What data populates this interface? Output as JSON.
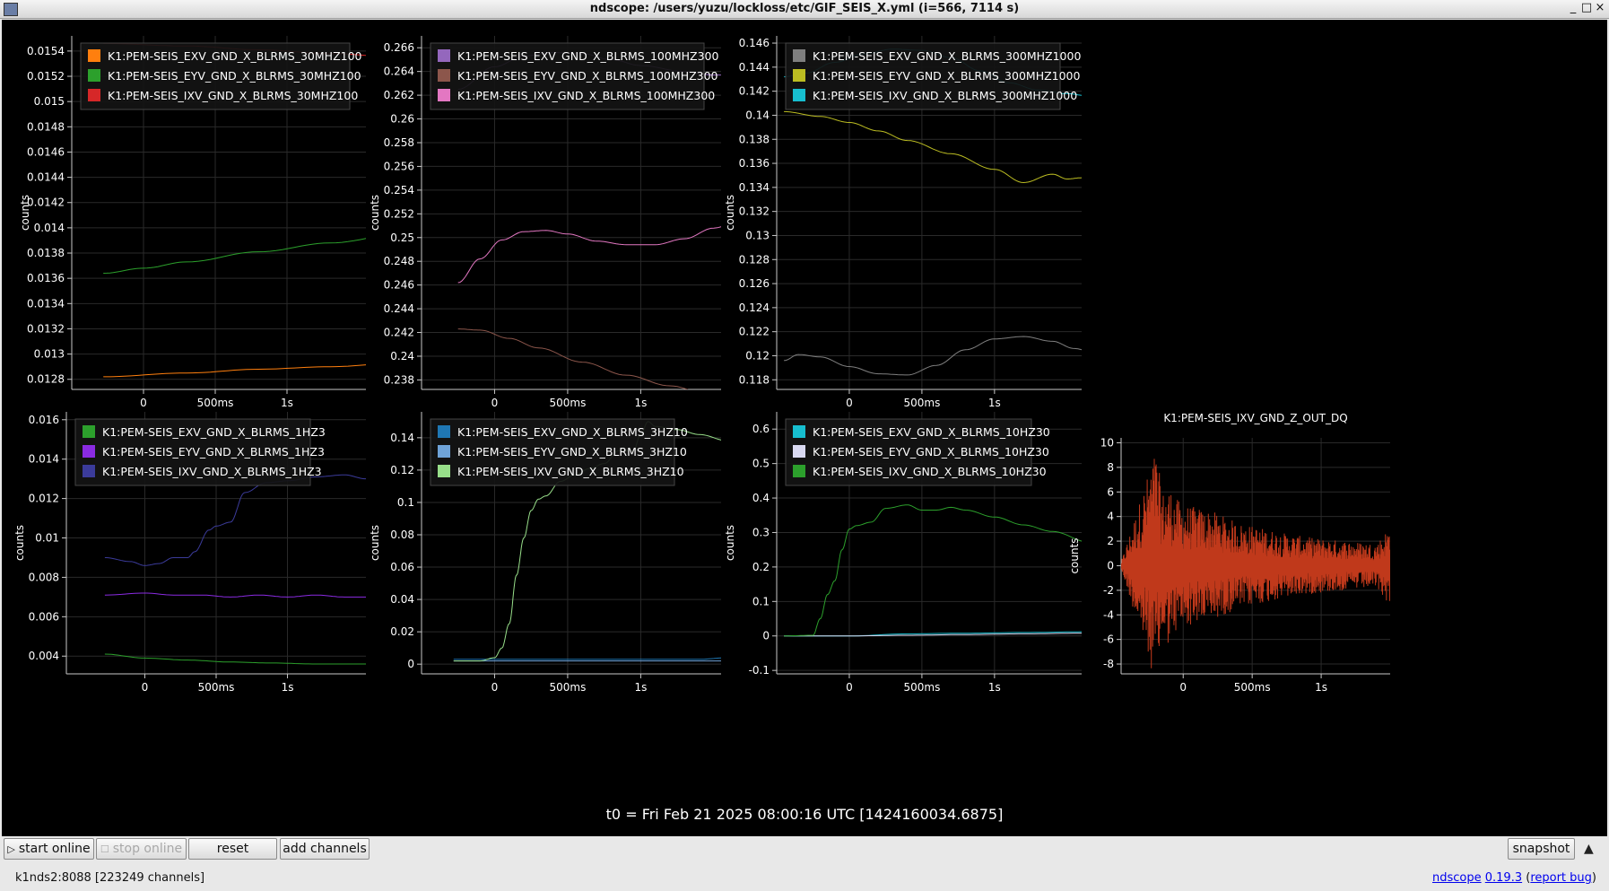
{
  "window": {
    "title": "ndscope: /users/yuzu/lockloss/etc/GIF_SEIS_X.yml (i=566, 7114 s)",
    "buttons": [
      "_",
      "□",
      "×"
    ]
  },
  "t0_label": "t0 = Fri Feb 21 2025 08:00:16 UTC [1424160034.6875]",
  "toolbar": {
    "start_online": "start online",
    "stop_online": "stop online",
    "reset": "reset",
    "add_channels": "add channels",
    "snapshot": "snapshot"
  },
  "status": {
    "server": "k1nds2:8088  [223249 channels]",
    "app": "ndscope",
    "version": "0.19.3",
    "report_open": "(",
    "report": "report bug",
    "report_close": ")"
  },
  "axes_common": {
    "ylabel": "counts",
    "xticks": [
      {
        "t": 0,
        "label": "0"
      },
      {
        "t": 0.5,
        "label": "500ms"
      },
      {
        "t": 1,
        "label": "1s"
      }
    ],
    "xlim": [
      -0.28,
      1.8
    ]
  },
  "colors": {
    "background": "#000000",
    "axis": "#c8c8c8",
    "grid": "#2a2a2a",
    "text": "#ffffff"
  },
  "chart_data": [
    {
      "type": "line",
      "ylim": [
        0.01272,
        0.01552
      ],
      "yticks": [
        "0.0154",
        "0.0152",
        "0.015",
        "0.0148",
        "0.0146",
        "0.0144",
        "0.0142",
        "0.014",
        "0.0138",
        "0.0136",
        "0.0134",
        "0.0132",
        "0.013",
        "0.0128"
      ],
      "series": [
        {
          "name": "K1:PEM-SEIS_EXV_GND_X_BLRMS_30MHZ100",
          "color": "#ff7f0e",
          "x": [
            -0.28,
            0.3,
            0.8,
            1.3,
            1.8
          ],
          "y": [
            0.01282,
            0.01285,
            0.01288,
            0.0129,
            0.01293
          ]
        },
        {
          "name": "K1:PEM-SEIS_EYV_GND_X_BLRMS_30MHZ100",
          "color": "#2ca02c",
          "x": [
            -0.28,
            0.0,
            0.3,
            0.8,
            1.3,
            1.8
          ],
          "y": [
            0.01364,
            0.01368,
            0.01373,
            0.01381,
            0.01388,
            0.01395
          ]
        },
        {
          "name": "K1:PEM-SEIS_IXV_GND_X_BLRMS_30MHZ100",
          "color": "#d62728",
          "x": [
            -0.28,
            0.3,
            0.8,
            1.3,
            1.8
          ],
          "y": [
            0.01546,
            0.01544,
            0.01541,
            0.01538,
            0.01535
          ]
        }
      ]
    },
    {
      "type": "line",
      "ylim": [
        0.2372,
        0.267
      ],
      "yticks": [
        "0.266",
        "0.264",
        "0.262",
        "0.26",
        "0.258",
        "0.256",
        "0.254",
        "0.252",
        "0.25",
        "0.248",
        "0.246",
        "0.244",
        "0.242",
        "0.24",
        "0.238"
      ],
      "series": [
        {
          "name": "K1:PEM-SEIS_EXV_GND_X_BLRMS_100MHZ300",
          "color": "#9467bd",
          "x": [
            -0.25,
            0.0,
            0.2,
            0.4,
            0.6,
            0.8,
            1.0,
            1.3,
            1.5,
            1.8
          ],
          "y": [
            0.2625,
            0.2644,
            0.2653,
            0.2656,
            0.2655,
            0.265,
            0.2645,
            0.264,
            0.2637,
            0.2637
          ]
        },
        {
          "name": "K1:PEM-SEIS_EYV_GND_X_BLRMS_100MHZ300",
          "color": "#8c564b",
          "x": [
            -0.25,
            -0.1,
            0.1,
            0.3,
            0.6,
            0.9,
            1.2,
            1.5,
            1.8
          ],
          "y": [
            0.2423,
            0.2422,
            0.2415,
            0.2407,
            0.2395,
            0.2384,
            0.2375,
            0.2366,
            0.2354
          ]
        },
        {
          "name": "K1:PEM-SEIS_IXV_GND_X_BLRMS_100MHZ300",
          "color": "#e377c2",
          "x": [
            -0.25,
            -0.1,
            0.05,
            0.2,
            0.35,
            0.5,
            0.7,
            0.9,
            1.1,
            1.3,
            1.5,
            1.8
          ],
          "y": [
            0.2462,
            0.2482,
            0.2498,
            0.2505,
            0.2506,
            0.2503,
            0.2497,
            0.2494,
            0.2494,
            0.2499,
            0.2508,
            0.2525
          ]
        }
      ]
    },
    {
      "type": "line",
      "ylim": [
        0.1172,
        0.1466
      ],
      "yticks": [
        "0.146",
        "0.144",
        "0.142",
        "0.14",
        "0.138",
        "0.136",
        "0.134",
        "0.132",
        "0.13",
        "0.128",
        "0.126",
        "0.124",
        "0.122",
        "0.12",
        "0.118"
      ],
      "series": [
        {
          "name": "K1:PEM-SEIS_EXV_GND_X_BLRMS_300MHZ1000",
          "color": "#7f7f7f",
          "x": [
            -0.45,
            -0.35,
            -0.2,
            0.0,
            0.2,
            0.4,
            0.6,
            0.8,
            1.0,
            1.2,
            1.4,
            1.55,
            1.65
          ],
          "y": [
            0.1196,
            0.1201,
            0.1199,
            0.1191,
            0.1185,
            0.1184,
            0.1192,
            0.1205,
            0.1214,
            0.1216,
            0.1212,
            0.1206,
            0.1204
          ]
        },
        {
          "name": "K1:PEM-SEIS_EYV_GND_X_BLRMS_300MHZ1000",
          "color": "#bcbd22",
          "x": [
            -0.45,
            -0.2,
            0.0,
            0.2,
            0.4,
            0.7,
            1.0,
            1.2,
            1.4,
            1.5,
            1.6,
            1.65
          ],
          "y": [
            0.1403,
            0.1399,
            0.1394,
            0.1387,
            0.1379,
            0.1368,
            0.1355,
            0.1344,
            0.1351,
            0.1347,
            0.1348,
            0.1348
          ]
        },
        {
          "name": "K1:PEM-SEIS_IXV_GND_X_BLRMS_300MHZ1000",
          "color": "#17becf",
          "x": [
            -0.45,
            -0.3,
            -0.1,
            0.1,
            0.3,
            0.5,
            0.7,
            0.9,
            1.1,
            1.3,
            1.5,
            1.65
          ],
          "y": [
            0.1432,
            0.1435,
            0.1444,
            0.1451,
            0.1455,
            0.1454,
            0.1448,
            0.1437,
            0.1427,
            0.1421,
            0.1418,
            0.1416
          ]
        }
      ]
    },
    {
      "type": "line",
      "ylim": [
        0.0031,
        0.0164
      ],
      "yticks": [
        "0.016",
        "0.014",
        "0.012",
        "0.01",
        "0.008",
        "0.006",
        "0.004"
      ],
      "series": [
        {
          "name": "K1:PEM-SEIS_EXV_GND_X_BLRMS_1HZ3",
          "color": "#2ca02c",
          "x": [
            -0.28,
            0.0,
            0.3,
            0.6,
            0.9,
            1.2,
            1.5,
            1.8
          ],
          "y": [
            0.0041,
            0.0039,
            0.0038,
            0.0037,
            0.00365,
            0.0036,
            0.0036,
            0.0036
          ]
        },
        {
          "name": "K1:PEM-SEIS_EYV_GND_X_BLRMS_1HZ3",
          "color": "#8a2be2",
          "x": [
            -0.28,
            0.0,
            0.2,
            0.4,
            0.6,
            0.8,
            1.0,
            1.2,
            1.4,
            1.6,
            1.8
          ],
          "y": [
            0.0071,
            0.0072,
            0.0071,
            0.0071,
            0.007,
            0.0071,
            0.007,
            0.0071,
            0.007,
            0.007,
            0.0069
          ]
        },
        {
          "name": "K1:PEM-SEIS_IXV_GND_X_BLRMS_1HZ3",
          "color": "#3b3b9a",
          "x": [
            -0.28,
            -0.1,
            0.0,
            0.1,
            0.2,
            0.3,
            0.35,
            0.45,
            0.5,
            0.6,
            0.7,
            0.85,
            1.0,
            1.2,
            1.4,
            1.55,
            1.65,
            1.72,
            1.8
          ],
          "y": [
            0.009,
            0.0088,
            0.0086,
            0.0087,
            0.009,
            0.009,
            0.0093,
            0.0104,
            0.0106,
            0.0108,
            0.0123,
            0.0128,
            0.0129,
            0.0131,
            0.0132,
            0.013,
            0.0133,
            0.0136,
            0.0149
          ]
        }
      ]
    },
    {
      "type": "line",
      "ylim": [
        -0.006,
        0.156
      ],
      "yticks": [
        "0.14",
        "0.12",
        "0.1",
        "0.08",
        "0.06",
        "0.04",
        "0.02",
        "0"
      ],
      "series": [
        {
          "name": "K1:PEM-SEIS_EXV_GND_X_BLRMS_3HZ10",
          "color": "#1f77b4",
          "x": [
            -0.28,
            0.3,
            0.8,
            1.0,
            1.2,
            1.4,
            1.6,
            1.75,
            1.8
          ],
          "y": [
            0.003,
            0.003,
            0.003,
            0.003,
            0.003,
            0.003,
            0.004,
            0.005,
            0.006
          ]
        },
        {
          "name": "K1:PEM-SEIS_EYV_GND_X_BLRMS_3HZ10",
          "color": "#6fa3d8",
          "x": [
            -0.28,
            0.3,
            0.8,
            1.3,
            1.8
          ],
          "y": [
            0.002,
            0.002,
            0.002,
            0.002,
            0.002
          ]
        },
        {
          "name": "K1:PEM-SEIS_IXV_GND_X_BLRMS_3HZ10",
          "color": "#98df8a",
          "x": [
            -0.28,
            -0.1,
            0.0,
            0.05,
            0.1,
            0.15,
            0.2,
            0.25,
            0.3,
            0.35,
            0.45,
            0.55,
            0.65,
            0.75,
            0.85,
            0.95,
            1.0,
            1.05,
            1.1,
            1.25,
            1.4,
            1.6,
            1.8
          ],
          "y": [
            0.002,
            0.002,
            0.004,
            0.01,
            0.025,
            0.055,
            0.078,
            0.095,
            0.102,
            0.104,
            0.113,
            0.117,
            0.121,
            0.124,
            0.132,
            0.132,
            0.142,
            0.15,
            0.147,
            0.145,
            0.142,
            0.138,
            0.131
          ]
        }
      ]
    },
    {
      "type": "line",
      "ylim": [
        -0.11,
        0.65
      ],
      "yticks": [
        "0.6",
        "0.5",
        "0.4",
        "0.3",
        "0.2",
        "0.1",
        "0",
        "-0.1"
      ],
      "series": [
        {
          "name": "K1:PEM-SEIS_EXV_GND_X_BLRMS_10HZ30",
          "color": "#17becf",
          "x": [
            -0.45,
            0.0,
            0.4,
            0.8,
            1.2,
            1.65
          ],
          "y": [
            0.0,
            0.0,
            0.006,
            0.008,
            0.01,
            0.012
          ]
        },
        {
          "name": "K1:PEM-SEIS_EYV_GND_X_BLRMS_10HZ30",
          "color": "#d8d8f0",
          "x": [
            -0.45,
            0.0,
            0.4,
            0.8,
            1.2,
            1.65
          ],
          "y": [
            0.0,
            0.0,
            0.002,
            0.004,
            0.006,
            0.008
          ]
        },
        {
          "name": "K1:PEM-SEIS_IXV_GND_X_BLRMS_10HZ30",
          "color": "#2ca02c",
          "x": [
            -0.45,
            -0.25,
            -0.2,
            -0.15,
            -0.1,
            -0.05,
            0.0,
            0.05,
            0.15,
            0.25,
            0.4,
            0.5,
            0.6,
            0.7,
            0.8,
            1.0,
            1.2,
            1.4,
            1.65
          ],
          "y": [
            0.0,
            0.002,
            0.05,
            0.12,
            0.16,
            0.25,
            0.31,
            0.32,
            0.33,
            0.37,
            0.38,
            0.365,
            0.365,
            0.373,
            0.365,
            0.345,
            0.322,
            0.303,
            0.272
          ]
        }
      ]
    },
    {
      "type": "line",
      "title": "K1:PEM-SEIS_IXV_GND_Z_OUT_DQ",
      "ylim": [
        -8.8,
        10.4
      ],
      "yticks": [
        "10",
        "8",
        "6",
        "4",
        "2",
        "0",
        "-2",
        "-4",
        "-6",
        "-8"
      ],
      "series": [
        {
          "name": "K1:PEM-SEIS_IXV_GND_Z_OUT_DQ",
          "color": "#c0391b",
          "x": [
            -0.45,
            -0.2,
            -0.15,
            -0.1,
            -0.05,
            0.0,
            0.2,
            0.4,
            0.6,
            0.8,
            1.0,
            1.2,
            1.4,
            1.55,
            1.65
          ],
          "y": [
            0.3,
            9.5,
            6.0,
            6.5,
            5.5,
            5.0,
            4.5,
            3.5,
            3.0,
            2.5,
            2.2,
            2.0,
            1.8,
            4.0,
            1.5
          ]
        }
      ]
    }
  ]
}
